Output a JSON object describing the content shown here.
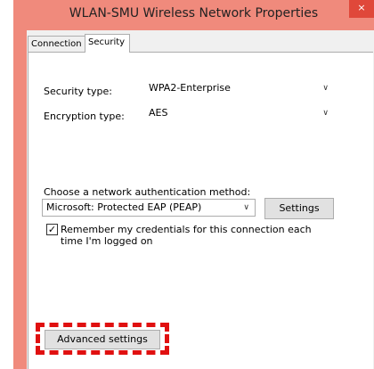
{
  "window": {
    "title": "WLAN-SMU Wireless Network Properties",
    "close_glyph": "×"
  },
  "tabs": [
    {
      "label": "Connection"
    },
    {
      "label": "Security"
    }
  ],
  "security": {
    "security_type_label": "Security type:",
    "security_type_value": "WPA2-Enterprise",
    "encryption_type_label": "Encryption type:",
    "encryption_type_value": "AES",
    "auth_method_label": "Choose a network authentication method:",
    "auth_method_value": "Microsoft: Protected EAP (PEAP)",
    "settings_button": "Settings",
    "remember_checked": true,
    "remember_line1": "Remember my credentials for this connection each",
    "remember_line2": "time I'm logged on",
    "advanced_button": "Advanced settings"
  },
  "colors": {
    "titlebar": "#f08a7c",
    "highlight_dashed": "#e01010"
  },
  "icons": {
    "dropdown": "chevron-down-icon",
    "check": "checkmark-icon"
  }
}
